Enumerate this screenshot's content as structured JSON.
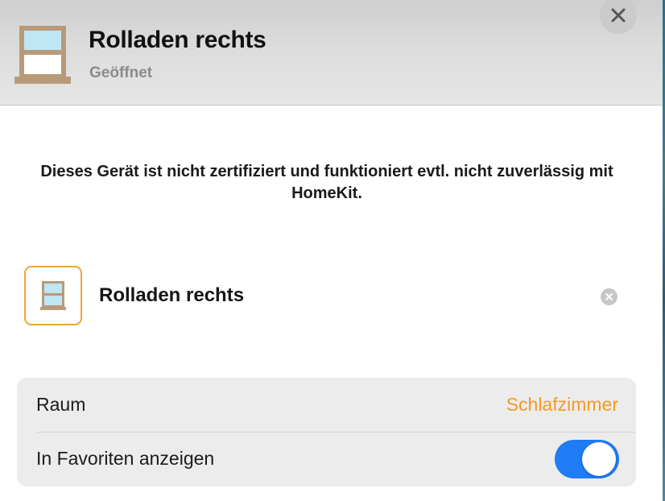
{
  "header": {
    "title": "Rolladen rechts",
    "status": "Geöffnet",
    "icon": "window-shutter-icon",
    "close_icon": "close-icon"
  },
  "warning": {
    "text": "Dieses Gerät ist nicht zertifiziert und funktioniert evtl. nicht zuverlässig mit HomeKit."
  },
  "device": {
    "name": "Rolladen rechts",
    "icon": "window-shutter-icon",
    "clear_icon": "clear-icon"
  },
  "settings": {
    "room_label": "Raum",
    "room_value": "Schlafzimmer",
    "favorites_label": "In Favoriten anzeigen",
    "favorites_enabled": true
  },
  "colors": {
    "accent": "#f39a26",
    "toggle_on": "#1f7cf5",
    "window_frame": "#b99a78",
    "window_glass": "#bfe6f5"
  }
}
